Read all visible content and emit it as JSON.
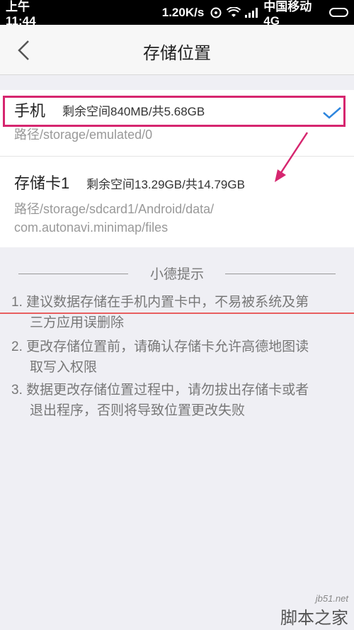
{
  "status_bar": {
    "time": "上午11:44",
    "speed": "1.20K/s",
    "carrier": "中国移动 4G"
  },
  "header": {
    "title": "存储位置"
  },
  "storage": {
    "items": [
      {
        "name": "手机",
        "space": "剩余空间840MB/共5.68GB",
        "path": "路径/storage/emulated/0",
        "selected": true
      },
      {
        "name": "存储卡1",
        "space": "剩余空间13.29GB/共14.79GB",
        "path_line1": "路径/storage/sdcard1/Android/data/",
        "path_line2": "com.autonavi.minimap/files",
        "selected": false
      }
    ]
  },
  "tips": {
    "title": "小德提示",
    "items": [
      {
        "line1": "1. 建议数据存储在手机内置卡中，不易被系统及第",
        "line2": "三方应用误删除"
      },
      {
        "line1": "2. 更改存储位置前，请确认存储卡允许高德地图读",
        "line2": "取写入权限"
      },
      {
        "line1": "3. 数据更改存储位置过程中，请勿拔出存储卡或者",
        "line2": "退出程序，否则将导致位置更改失败"
      }
    ]
  },
  "watermark": {
    "site": "jb51.net",
    "text": "脚本之家"
  },
  "colors": {
    "highlight": "#d6266f",
    "check": "#2e86de",
    "annotation_line": "#e64545"
  }
}
